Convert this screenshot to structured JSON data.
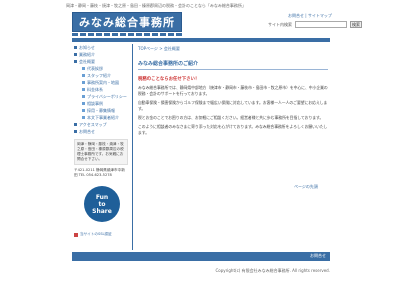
{
  "header": {
    "tagline": "岡津・静岡・藤枝・焼津・牧之原・島田・榛原郡周辺の税務・会計のことなら「みなみ総合事務所」",
    "logo_text": "みなみ総合事務所",
    "util_links": "お問合せ | サイトマップ",
    "search_label": "サイト内検索",
    "search_placeholder": "",
    "search_button": "検索"
  },
  "sidebar": {
    "items": [
      {
        "label": "お知らせ",
        "sub": false
      },
      {
        "label": "業務紹介",
        "sub": false
      },
      {
        "label": "会社概要",
        "sub": false
      },
      {
        "label": "代表挨拶",
        "sub": true
      },
      {
        "label": "スタッフ紹介",
        "sub": true
      },
      {
        "label": "事務所案内・地図",
        "sub": true
      },
      {
        "label": "料金体系",
        "sub": true
      },
      {
        "label": "プライバシーポリシー",
        "sub": true
      },
      {
        "label": "相談事例",
        "sub": true
      },
      {
        "label": "採用・募集情報",
        "sub": true
      },
      {
        "label": "本文下事業者紹介",
        "sub": true
      },
      {
        "label": "アクセスマップ",
        "sub": false
      },
      {
        "label": "お問合せ",
        "sub": false
      }
    ],
    "info_box": "岡津・静岡・藤枝・焼津・牧之原・島田・榛原郡周辺の税理士事務所です。お気軽にお問合せ下さい。",
    "address": "〒421-0211 静岡県焼津市中新田 TEL 054-623-5278",
    "badge_line1": "Fun",
    "badge_line2": "to",
    "badge_line3": "Share",
    "bottom_link": "当サイトのSSL認証"
  },
  "main": {
    "breadcrumb": "TOPページ > 会社概要",
    "title": "みなみ総合事務所のご紹介",
    "subtitle": "税務のことならお任せ下さい！",
    "paragraphs": [
      "みなみ総合事務所では、静岡県中部地方（焼津市・静岡市・藤枝市・島田市・牧之原市）を中心に、中小企業の税務・会計のサポートを行っております。",
      "自動車保険・損害保険からゴルフ保険まで幅広い保険に対応しています。お客様一人一人のご要望にお応えします。",
      "税とお金のことでお困りの方は、お気軽にご相談ください。経営者様と共に歩む事務所を目指しております。",
      "このように相談者のみなさまに寄り添った対応を心がけております。みなみ総合事務所をよろしくお願いいたします。"
    ],
    "page_top": "ページの先頭"
  },
  "footer": {
    "link": "お問合せ",
    "copyright": "Copyright(c) 有限会社みなみ総合事務所. All rights reserved."
  }
}
